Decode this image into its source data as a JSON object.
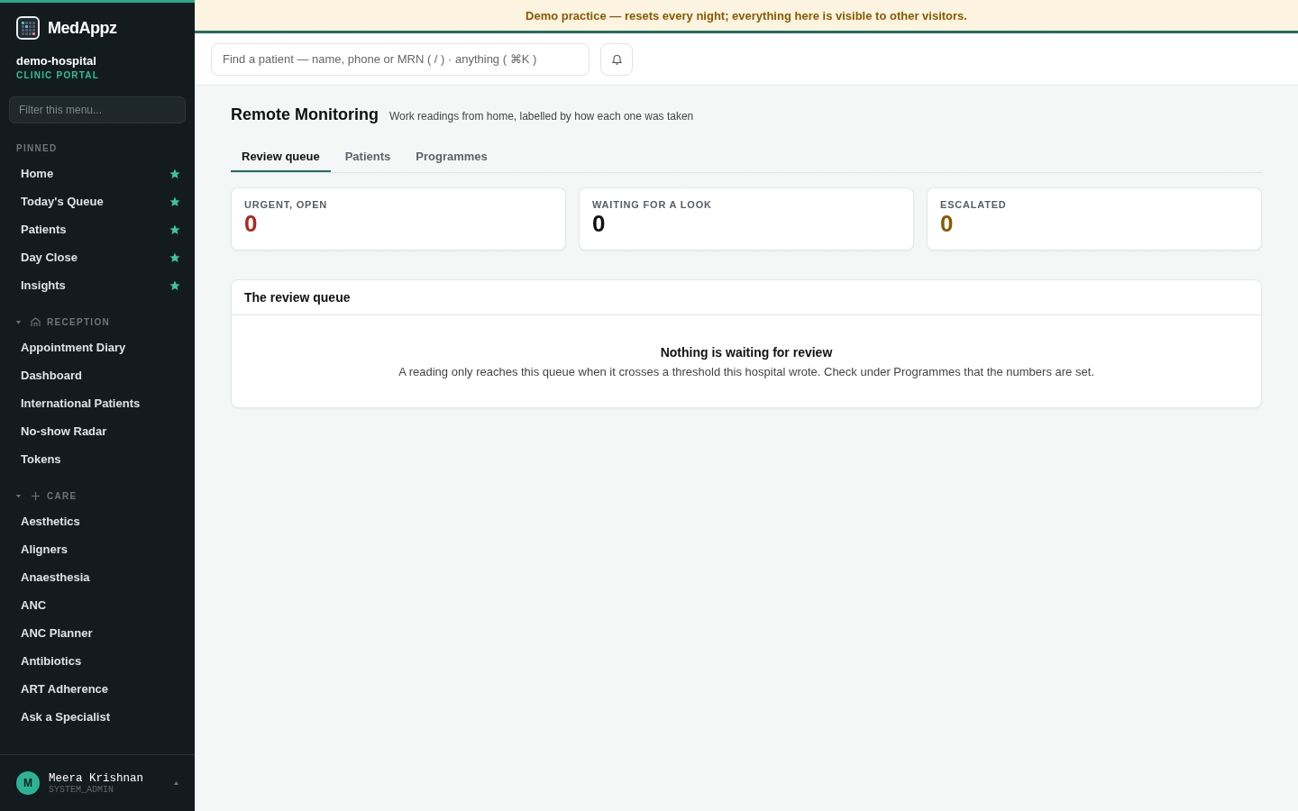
{
  "brand": {
    "name": "MedAppz",
    "org": "demo-hospital",
    "portal": "CLINIC PORTAL"
  },
  "sidebar": {
    "filter_placeholder": "Filter this menu...",
    "pinned_label": "PINNED",
    "pinned": [
      {
        "label": "Home"
      },
      {
        "label": "Today's Queue"
      },
      {
        "label": "Patients"
      },
      {
        "label": "Day Close"
      },
      {
        "label": "Insights"
      }
    ],
    "sections": [
      {
        "label": "RECEPTION",
        "kind": "home",
        "expanded": true,
        "items": [
          "Appointment Diary",
          "Dashboard",
          "International Patients",
          "No-show Radar",
          "Tokens"
        ]
      },
      {
        "label": "CARE",
        "kind": "plus",
        "expanded": true,
        "items": [
          "Aesthetics",
          "Aligners",
          "Anaesthesia",
          "ANC",
          "ANC Planner",
          "Antibiotics",
          "ART Adherence",
          "Ask a Specialist"
        ]
      }
    ]
  },
  "user": {
    "initial": "M",
    "name": "Meera Krishnan",
    "role": "SYSTEM_ADMIN"
  },
  "banner": "Demo practice — resets every night; everything here is visible to other visitors.",
  "search": {
    "placeholder": "Find a patient — name, phone or MRN ( / ) · anything ( ⌘K )"
  },
  "page": {
    "title": "Remote Monitoring",
    "subtitle": "Work readings from home, labelled by how each one was taken"
  },
  "tabs": [
    {
      "label": "Review queue",
      "selected": true
    },
    {
      "label": "Patients",
      "selected": false
    },
    {
      "label": "Programmes",
      "selected": false
    }
  ],
  "stats": [
    {
      "label": "URGENT, OPEN",
      "value": "0",
      "color": "#b3261e"
    },
    {
      "label": "WAITING FOR A LOOK",
      "value": "0",
      "color": "#111111"
    },
    {
      "label": "ESCALATED",
      "value": "0",
      "color": "#8a5a00"
    }
  ],
  "queue": {
    "title": "The review queue",
    "empty_title": "Nothing is waiting for review",
    "empty_text": "A reading only reaches this queue when it crosses a threshold this hospital wrote. Check under Programmes that the numbers are set."
  }
}
